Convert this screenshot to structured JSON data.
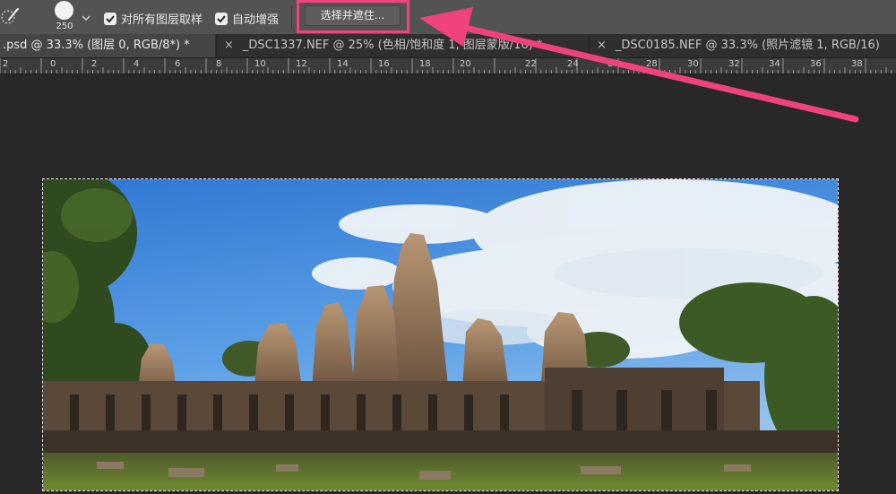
{
  "options_bar": {
    "brush_size": "250",
    "sample_all_layers_label": "对所有图层取样",
    "sample_all_layers_checked": true,
    "auto_enhance_label": "自动增强",
    "auto_enhance_checked": true,
    "select_and_mask_label": "选择并遮住..."
  },
  "tabs": [
    {
      "title": ".psd @ 33.3% (图层 0, RGB/8*) *",
      "active": true
    },
    {
      "title": "_DSC1337.NEF @ 25% (色相/饱和度 1, 图层蒙版/16) *",
      "active": false
    },
    {
      "title": "_DSC0185.NEF @ 33.3% (照片滤镜 1, RGB/16)",
      "active": false
    }
  ],
  "tab_close_glyph": "×",
  "ruler_numbers": [
    "2",
    "0",
    "2",
    "4",
    "6",
    "8",
    "10",
    "12",
    "14",
    "16",
    "18",
    "20",
    "22",
    "24",
    "26",
    "28",
    "30",
    "32",
    "34",
    "36",
    "38"
  ],
  "colors": {
    "highlight": "#f0437e",
    "options_bar": "#535353",
    "canvas": "#282828"
  },
  "icons": {
    "tool": "quick-selection-brush-icon",
    "brush_preview": "brush-tip-icon",
    "caret": "chevron-down-icon",
    "check": "checkmark-icon"
  }
}
